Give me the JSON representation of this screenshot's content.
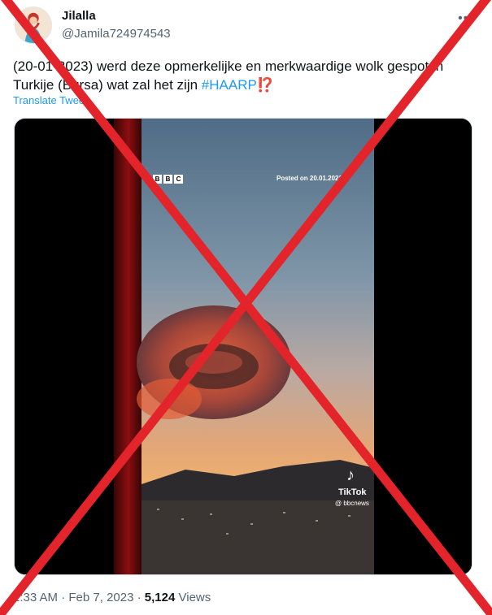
{
  "author": {
    "display_name": "Jilalla",
    "handle": "@Jamila724974543"
  },
  "tweet": {
    "text_part1": "(20-01-2023) werd deze opmerkelijke en merkwaardige wolk gespot in Turkije (Bursa) wat zal het zijn ",
    "hashtag": "#HAARP",
    "emoji": "⁉️",
    "translate_label": "Translate Tweet"
  },
  "media": {
    "bbc_letters": [
      "B",
      "B",
      "C"
    ],
    "posted_on": "Posted on 20.01.2023",
    "tiktok_logo": "♪",
    "tiktok_name": "TikTok",
    "tiktok_handle": "@ bbcnews"
  },
  "meta": {
    "time": "2:33 AM",
    "separator": " · ",
    "date": "Feb 7, 2023",
    "views_count": "5,124",
    "views_label": " Views"
  },
  "icons": {
    "more": "more-icon",
    "tiktok": "tiktok-icon"
  },
  "colors": {
    "link": "#1d9bf0",
    "cross": "#e3242b",
    "muted": "#536471"
  }
}
